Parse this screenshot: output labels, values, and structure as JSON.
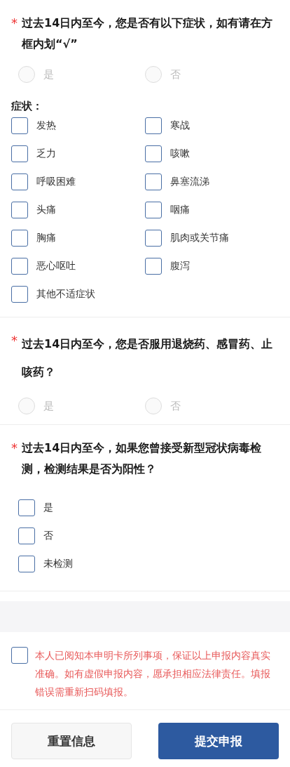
{
  "questions": [
    {
      "marker": "*",
      "title": "过去14日内至今，您是否有以下症状，如有请在方框内划“√”",
      "options": [
        {
          "label": "是",
          "selected": false,
          "disabled": true
        },
        {
          "label": "否",
          "selected": false,
          "disabled": true
        }
      ],
      "symptoms": {
        "label": "症状：",
        "items": [
          {
            "label": "发热",
            "checked": false
          },
          {
            "label": "寒战",
            "checked": false
          },
          {
            "label": "乏力",
            "checked": false
          },
          {
            "label": "咳嗽",
            "checked": false
          },
          {
            "label": "呼吸困难",
            "checked": false
          },
          {
            "label": "鼻塞流涕",
            "checked": false
          },
          {
            "label": "头痛",
            "checked": false
          },
          {
            "label": "咽痛",
            "checked": false
          },
          {
            "label": "胸痛",
            "checked": false
          },
          {
            "label": "肌肉或关节痛",
            "checked": false
          },
          {
            "label": "恶心呕吐",
            "checked": false
          },
          {
            "label": "腹泻",
            "checked": false
          },
          {
            "label": "其他不适症状",
            "checked": false
          }
        ]
      }
    },
    {
      "marker": "*",
      "title": "过去14日内至今，您是否服用退烧药、感冒药、止咳药？",
      "options": [
        {
          "label": "是",
          "selected": false,
          "disabled": true
        },
        {
          "label": "否",
          "selected": false,
          "disabled": true
        }
      ]
    },
    {
      "marker": "*",
      "title": "过去14日内至今，如果您曾接受新型冠状病毒检测，检测结果是否为阳性？",
      "checks": [
        {
          "label": "是",
          "checked": false
        },
        {
          "label": "否",
          "checked": false
        },
        {
          "label": "未检测",
          "checked": false
        }
      ]
    }
  ],
  "declaration": {
    "checked": false,
    "text": "本人已阅知本申明卡所列事项，保证以上申报内容真实准确。如有虚假申报内容，愿承担相应法律责任。填报错误需重新扫码填报。"
  },
  "buttons": [
    {
      "label": "重置信息",
      "kind": "secondary"
    },
    {
      "label": "提交申报",
      "kind": "primary"
    }
  ]
}
